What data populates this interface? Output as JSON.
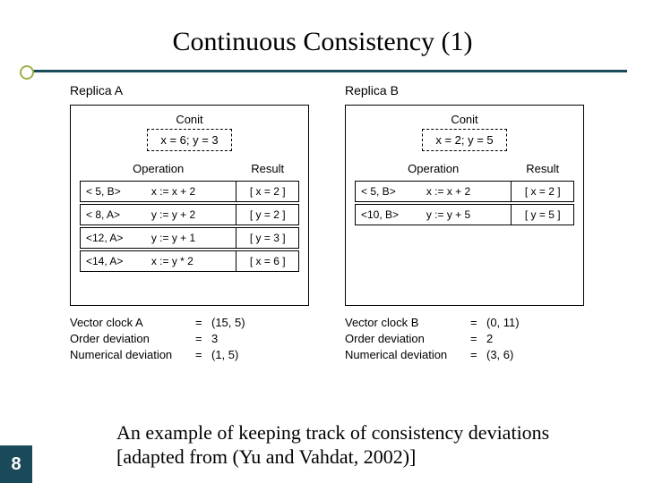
{
  "title": "Continuous Consistency (1)",
  "replicaA": {
    "label": "Replica A",
    "conitLabel": "Conit",
    "conitValue": "x = 6; y = 3",
    "headers": {
      "op": "Operation",
      "res": "Result"
    },
    "ops": [
      {
        "tag": "< 5, B>",
        "expr": "x := x + 2",
        "res": "[ x = 2 ]"
      },
      {
        "tag": "< 8, A>",
        "expr": "y := y + 2",
        "res": "[ y = 2 ]"
      },
      {
        "tag": "<12, A>",
        "expr": "y := y + 1",
        "res": "[ y = 3 ]"
      },
      {
        "tag": "<14, A>",
        "expr": "x := y * 2",
        "res": "[ x = 6 ]"
      }
    ],
    "stats": {
      "vc": {
        "label": "Vector clock A",
        "val": "(15, 5)"
      },
      "od": {
        "label": "Order deviation",
        "val": "3"
      },
      "nd": {
        "label": "Numerical deviation",
        "val": "(1, 5)"
      }
    }
  },
  "replicaB": {
    "label": "Replica B",
    "conitLabel": "Conit",
    "conitValue": "x = 2; y = 5",
    "headers": {
      "op": "Operation",
      "res": "Result"
    },
    "ops": [
      {
        "tag": "< 5, B>",
        "expr": "x := x + 2",
        "res": "[ x = 2 ]"
      },
      {
        "tag": "<10, B>",
        "expr": "y := y + 5",
        "res": "[ y = 5 ]"
      }
    ],
    "stats": {
      "vc": {
        "label": "Vector clock B",
        "val": "(0, 11)"
      },
      "od": {
        "label": "Order deviation",
        "val": "2"
      },
      "nd": {
        "label": "Numerical deviation",
        "val": "(3, 6)"
      }
    }
  },
  "caption": "An example of keeping track of consistency deviations [adapted from (Yu and Vahdat, 2002)]",
  "pageNumber": "8"
}
